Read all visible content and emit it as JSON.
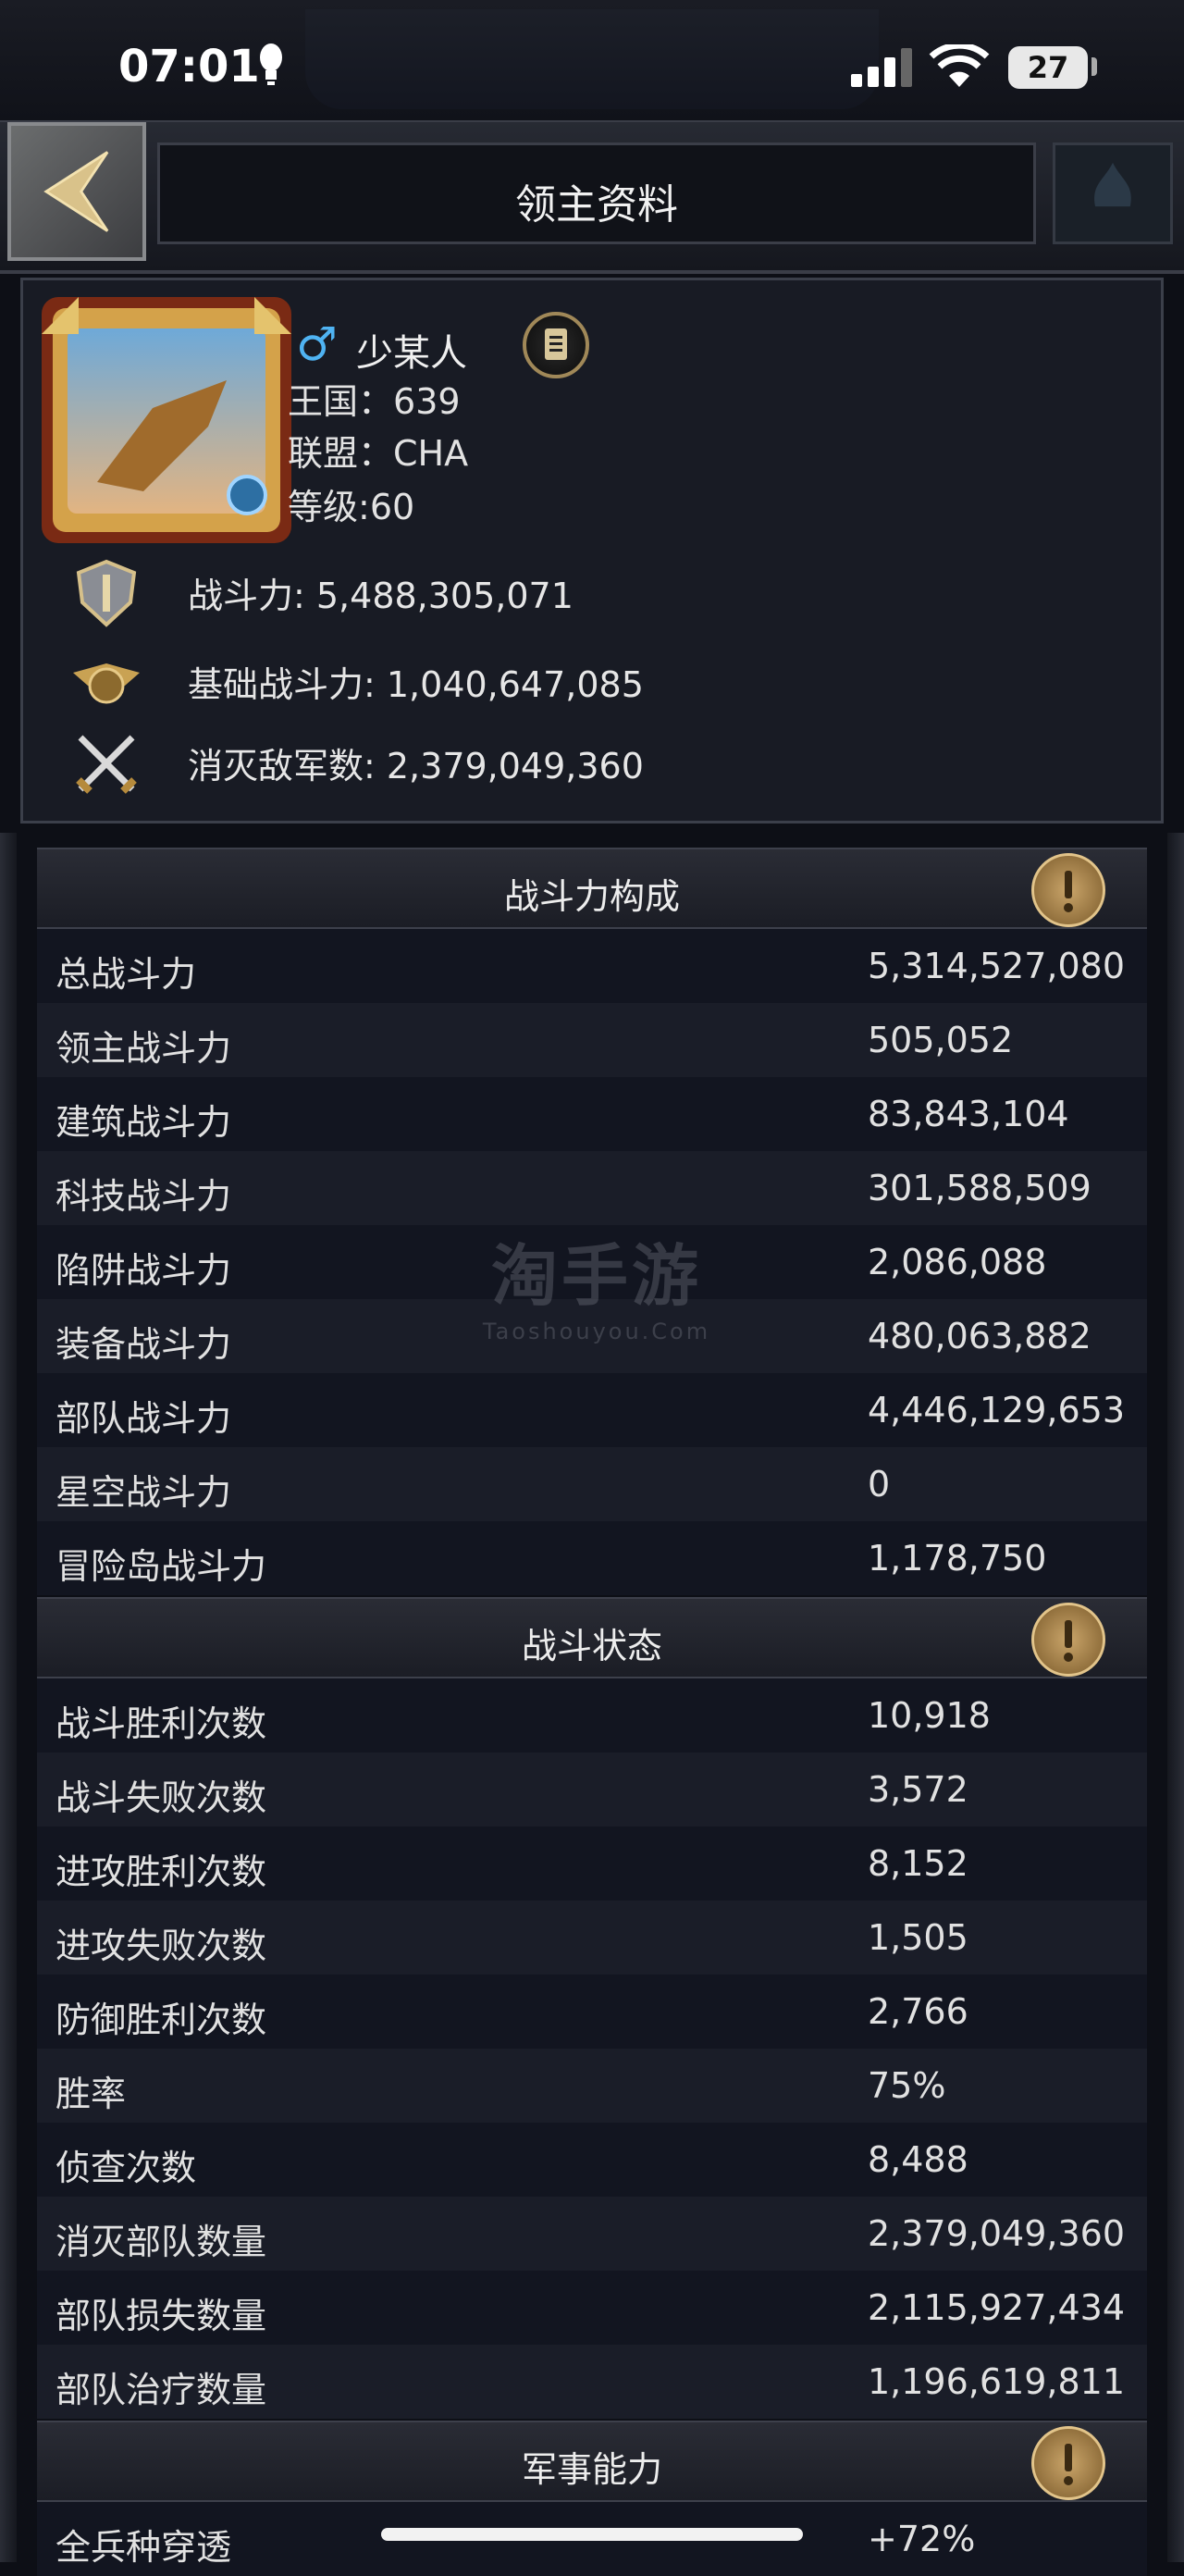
{
  "status_bar": {
    "time": "07:01",
    "battery": "27"
  },
  "header": {
    "title": "领主资料"
  },
  "profile": {
    "gender_symbol": "♂",
    "name": "少某人",
    "kingdom_label": "王国：",
    "kingdom": "639",
    "alliance_label": "联盟：",
    "alliance": "CHA",
    "level_label": "等级:",
    "level": "60",
    "power": "战斗力: 5,488,305,071",
    "base_power": "基础战斗力: 1,040,647,085",
    "kills": "消灭敌军数: 2,379,049,360"
  },
  "power_section": {
    "title": "战斗力构成",
    "rows": [
      {
        "label": "总战斗力",
        "value": "5,314,527,080"
      },
      {
        "label": "领主战斗力",
        "value": "505,052"
      },
      {
        "label": "建筑战斗力",
        "value": "83,843,104"
      },
      {
        "label": "科技战斗力",
        "value": "301,588,509"
      },
      {
        "label": "陷阱战斗力",
        "value": "2,086,088"
      },
      {
        "label": "装备战斗力",
        "value": "480,063,882"
      },
      {
        "label": "部队战斗力",
        "value": "4,446,129,653"
      },
      {
        "label": "星空战斗力",
        "value": "0"
      },
      {
        "label": "冒险岛战斗力",
        "value": "1,178,750"
      }
    ]
  },
  "battle_section": {
    "title": "战斗状态",
    "rows": [
      {
        "label": "战斗胜利次数",
        "value": "10,918"
      },
      {
        "label": "战斗失败次数",
        "value": "3,572"
      },
      {
        "label": "进攻胜利次数",
        "value": "8,152"
      },
      {
        "label": "进攻失败次数",
        "value": "1,505"
      },
      {
        "label": "防御胜利次数",
        "value": "2,766"
      },
      {
        "label": "胜率",
        "value": "75%"
      },
      {
        "label": "侦查次数",
        "value": "8,488"
      },
      {
        "label": "消灭部队数量",
        "value": "2,379,049,360"
      },
      {
        "label": "部队损失数量",
        "value": "2,115,927,434"
      },
      {
        "label": "部队治疗数量",
        "value": "1,196,619,811"
      }
    ]
  },
  "military_section": {
    "title": "军事能力",
    "rows": [
      {
        "label": "全兵种穿透",
        "value": "+72%"
      }
    ]
  },
  "watermark": {
    "main": "淘手游",
    "sub": "Taoshouyou.Com"
  }
}
